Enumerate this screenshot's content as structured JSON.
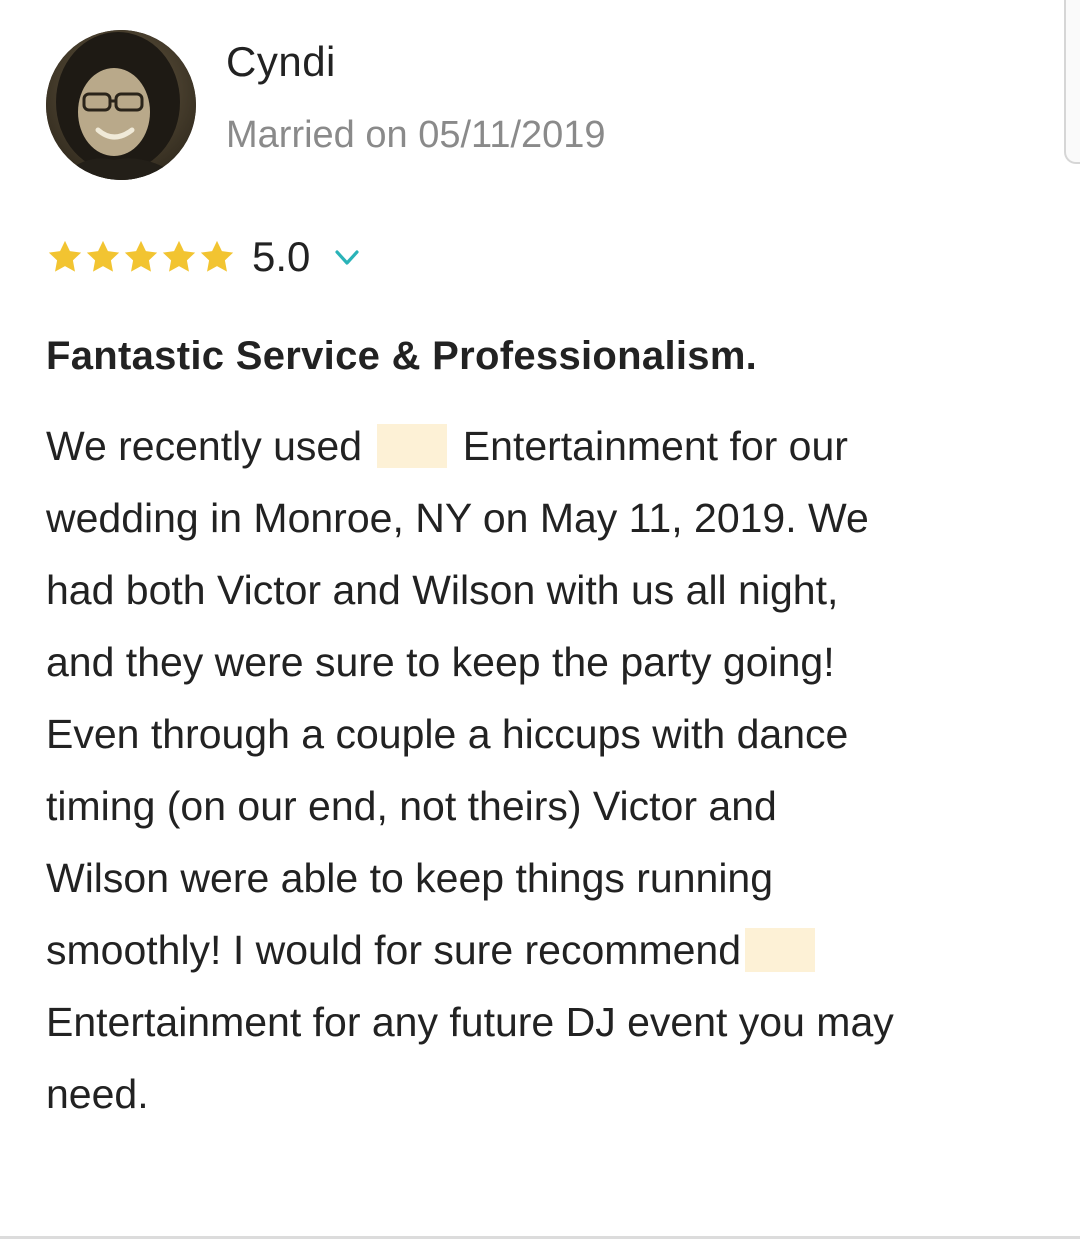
{
  "reviewer": {
    "name": "Cyndi",
    "married_text": "Married on 05/11/2019"
  },
  "rating": {
    "stars_filled": 5,
    "stars_total": 5,
    "value_text": "5.0",
    "star_color": "#f2c431",
    "chevron_icon": "chevron-down-icon",
    "chevron_color": "#2ab3b8"
  },
  "review": {
    "title": "Fantastic Service & Professionalism.",
    "lines": [
      [
        "We recently used ",
        "",
        " Entertainment for our"
      ],
      [
        "wedding in Monroe, NY on May 11, 2019. We"
      ],
      [
        "had both Victor and Wilson with us all night,"
      ],
      [
        "and they were sure to keep the party going!"
      ],
      [
        "Even through a couple a hiccups with dance"
      ],
      [
        "timing (on our end, not theirs) Victor and"
      ],
      [
        "Wilson were able to keep things running"
      ],
      [
        "smoothly! I would for sure recommend",
        ""
      ],
      [
        "Entertainment for any future DJ event you may"
      ],
      [
        "need."
      ]
    ],
    "redaction_color": "#fdf1d6"
  }
}
